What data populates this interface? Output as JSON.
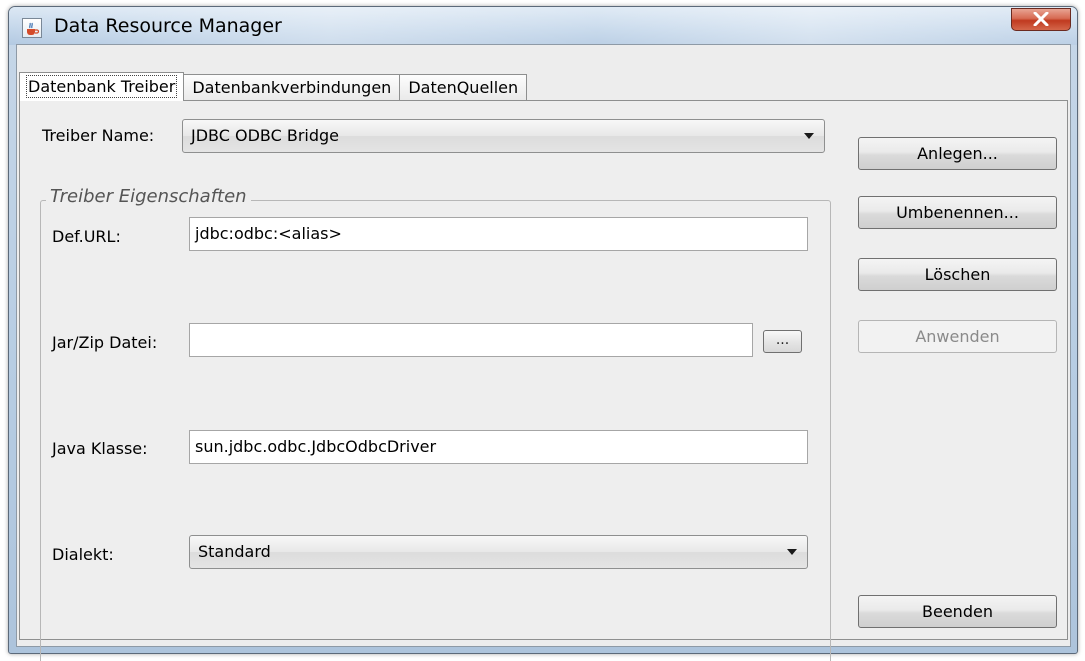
{
  "window": {
    "title": "Data Resource Manager"
  },
  "tabs": [
    {
      "label": "Datenbank Treiber",
      "active": true
    },
    {
      "label": "Datenbankverbindungen",
      "active": false
    },
    {
      "label": "DatenQuellen",
      "active": false
    }
  ],
  "driver": {
    "name_label": "Treiber Name:",
    "name_value": "JDBC ODBC Bridge"
  },
  "properties": {
    "legend": "Treiber Eigenschaften",
    "url_label": "Def.URL:",
    "url_value": "jdbc:odbc:<alias>",
    "jar_label": "Jar/Zip Datei:",
    "jar_value": "",
    "browse_label": "...",
    "class_label": "Java Klasse:",
    "class_value": "sun.jdbc.odbc.JdbcOdbcDriver",
    "dialect_label": "Dialekt:",
    "dialect_value": "Standard"
  },
  "buttons": {
    "create": "Anlegen...",
    "rename": "Umbenennen...",
    "delete": "Löschen",
    "apply": "Anwenden",
    "exit": "Beenden"
  },
  "icons": {
    "app": "java-cup-icon",
    "close": "close-icon"
  }
}
